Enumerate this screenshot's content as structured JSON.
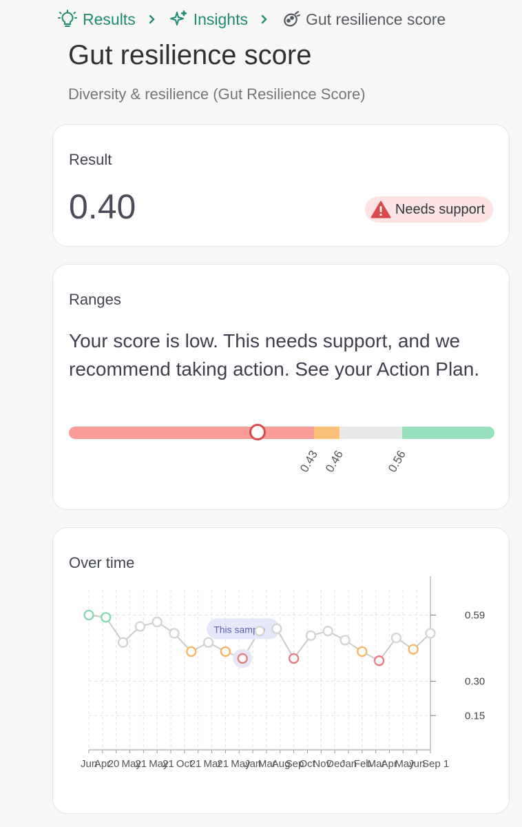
{
  "breadcrumb": {
    "items": [
      {
        "label": "Results",
        "icon": "lightbulb-icon"
      },
      {
        "label": "Insights",
        "icon": "sparkle-icon"
      },
      {
        "label": "Gut resilience score",
        "icon": "bacteria-icon"
      }
    ]
  },
  "page": {
    "title": "Gut resilience score",
    "subtitle": "Diversity & resilience (Gut Resilience Score)"
  },
  "result": {
    "label": "Result",
    "value": "0.40",
    "status": "Needs support",
    "status_icon": "warning-icon"
  },
  "ranges": {
    "label": "Ranges",
    "description": "Your score is low. This needs support, and we recommend taking action. See your Action Plan.",
    "marker_value": 0.4,
    "thresholds": [
      0.43,
      0.46,
      0.56
    ],
    "thresholds_text": [
      "0.43",
      "0.46",
      "0.56"
    ],
    "colors": {
      "low": "#f89c98",
      "mid": "#f9c07a",
      "neutral": "#e9e9e7",
      "high": "#98dfbc"
    }
  },
  "overtime": {
    "label": "Over time",
    "tooltip": "This sample"
  },
  "chart_data": {
    "type": "line",
    "ylim": [
      0,
      0.7
    ],
    "yticks": [
      0.59,
      0.3,
      0.15
    ],
    "ytick_labels": [
      "0.59",
      "0.30",
      "0.15"
    ],
    "x": [
      "Jun",
      "Apr",
      "20",
      "May",
      "21",
      "May",
      "21",
      "Oct",
      "21",
      "Mar",
      "21",
      "May",
      "Jan",
      "Mar",
      "Aug",
      "Sep",
      "Oct",
      "Nov",
      "Dec",
      "Jan",
      "Feb",
      "Mar",
      "Apr",
      "May",
      "Jun",
      "Sep 1"
    ],
    "series": [
      {
        "values": [
          0.59,
          0.58,
          0.47,
          0.54,
          0.56,
          0.51,
          0.43,
          0.47,
          0.43,
          0.4,
          0.52,
          0.53,
          0.4,
          0.5,
          0.52,
          0.48,
          0.43,
          0.39,
          0.49,
          0.44,
          0.51
        ],
        "point_colors": [
          "green",
          "green",
          "grey",
          "grey",
          "grey",
          "grey",
          "orange",
          "grey",
          "orange",
          "red",
          "grey",
          "grey",
          "red",
          "grey",
          "grey",
          "grey",
          "orange",
          "red",
          "grey",
          "orange",
          "grey"
        ]
      }
    ],
    "highlight_index": 9,
    "colors": {
      "green": "#86d9ae",
      "orange": "#f5b766",
      "red": "#ea7b86",
      "grey": "#d4d4d2",
      "line": "#cacac8"
    }
  }
}
